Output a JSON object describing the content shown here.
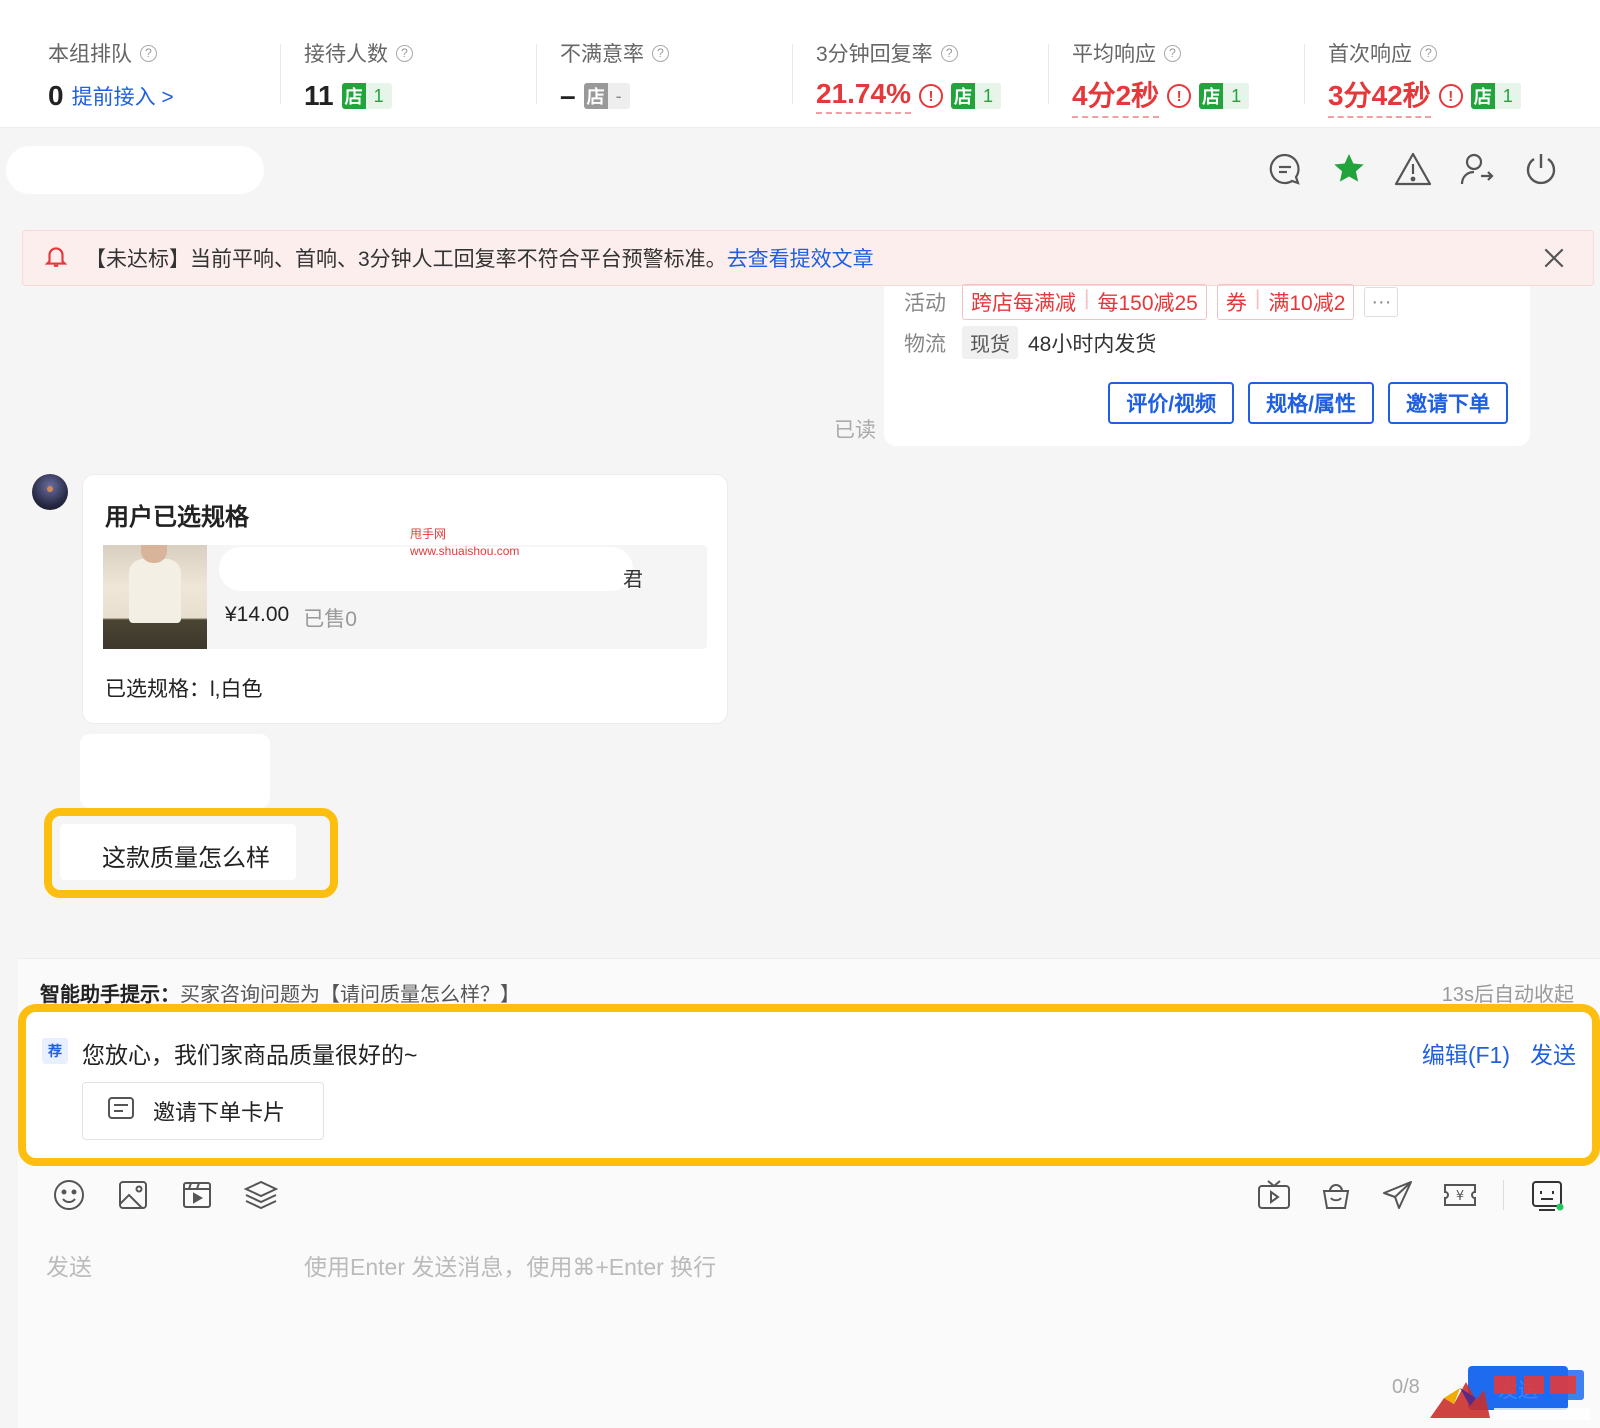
{
  "stats": [
    {
      "label": "本组排队",
      "value": "0",
      "link": "提前接入 >"
    },
    {
      "label": "接待人数",
      "value": "11",
      "badge_d": "店",
      "badge_n": "1"
    },
    {
      "label": "不满意率",
      "value": "–",
      "badge_d": "店",
      "badge_n": "-"
    },
    {
      "label": "3分钟回复率",
      "value": "21.74%",
      "badge_d": "店",
      "badge_n": "1"
    },
    {
      "label": "平均响应",
      "value": "4分2秒",
      "badge_d": "店",
      "badge_n": "1"
    },
    {
      "label": "首次响应",
      "value": "3分42秒",
      "badge_d": "店",
      "badge_n": "1"
    }
  ],
  "top_icons": [
    "chat-bubble-icon",
    "star-icon",
    "warning-icon",
    "user-transfer-icon",
    "power-icon"
  ],
  "alert": {
    "text": "【未达标】当前平响、首响、3分钟人工回复率不符合平台预警标准。",
    "link": "去查看提效文章"
  },
  "product_card": {
    "activity_label": "活动",
    "promo1_a": "跨店每满减",
    "promo1_b": "每150减25",
    "promo2_a": "券",
    "promo2_b": "满10减2",
    "more": "···",
    "logistics_label": "物流",
    "stock_tag": "现货",
    "shipping": "48小时内发货",
    "buttons": [
      "评价/视频",
      "规格/属性",
      "邀请下单"
    ],
    "read": "已读"
  },
  "spec_message": {
    "title": "用户已选规格",
    "name_tail": "君",
    "price": "¥14.00",
    "sold": "已售0",
    "selected": "已选规格：l,白色"
  },
  "watermark": {
    "line1": "甩手网",
    "line2": "www.shuaishou.com"
  },
  "question": "这款质量怎么样",
  "assistant": {
    "tip_label": "智能助手提示：",
    "tip_text": "买家咨询问题为【请问质量怎么样？】",
    "collapse": "13s后自动收起",
    "rec_badge": "荐",
    "suggestion": "您放心，我们家商品质量很好的~",
    "edit": "编辑(F1)",
    "send": "发送",
    "invite_card": "邀请下单卡片"
  },
  "input": {
    "placeholder": "发送",
    "hint": "使用Enter 发送消息，使用⌘+Enter 换行",
    "counter": "0/8",
    "send_button": "发送"
  },
  "colors": {
    "accent": "#1f5fe0",
    "alert_red": "#e5383b",
    "highlight": "#fdbf0f",
    "store_green": "#22a33b"
  }
}
